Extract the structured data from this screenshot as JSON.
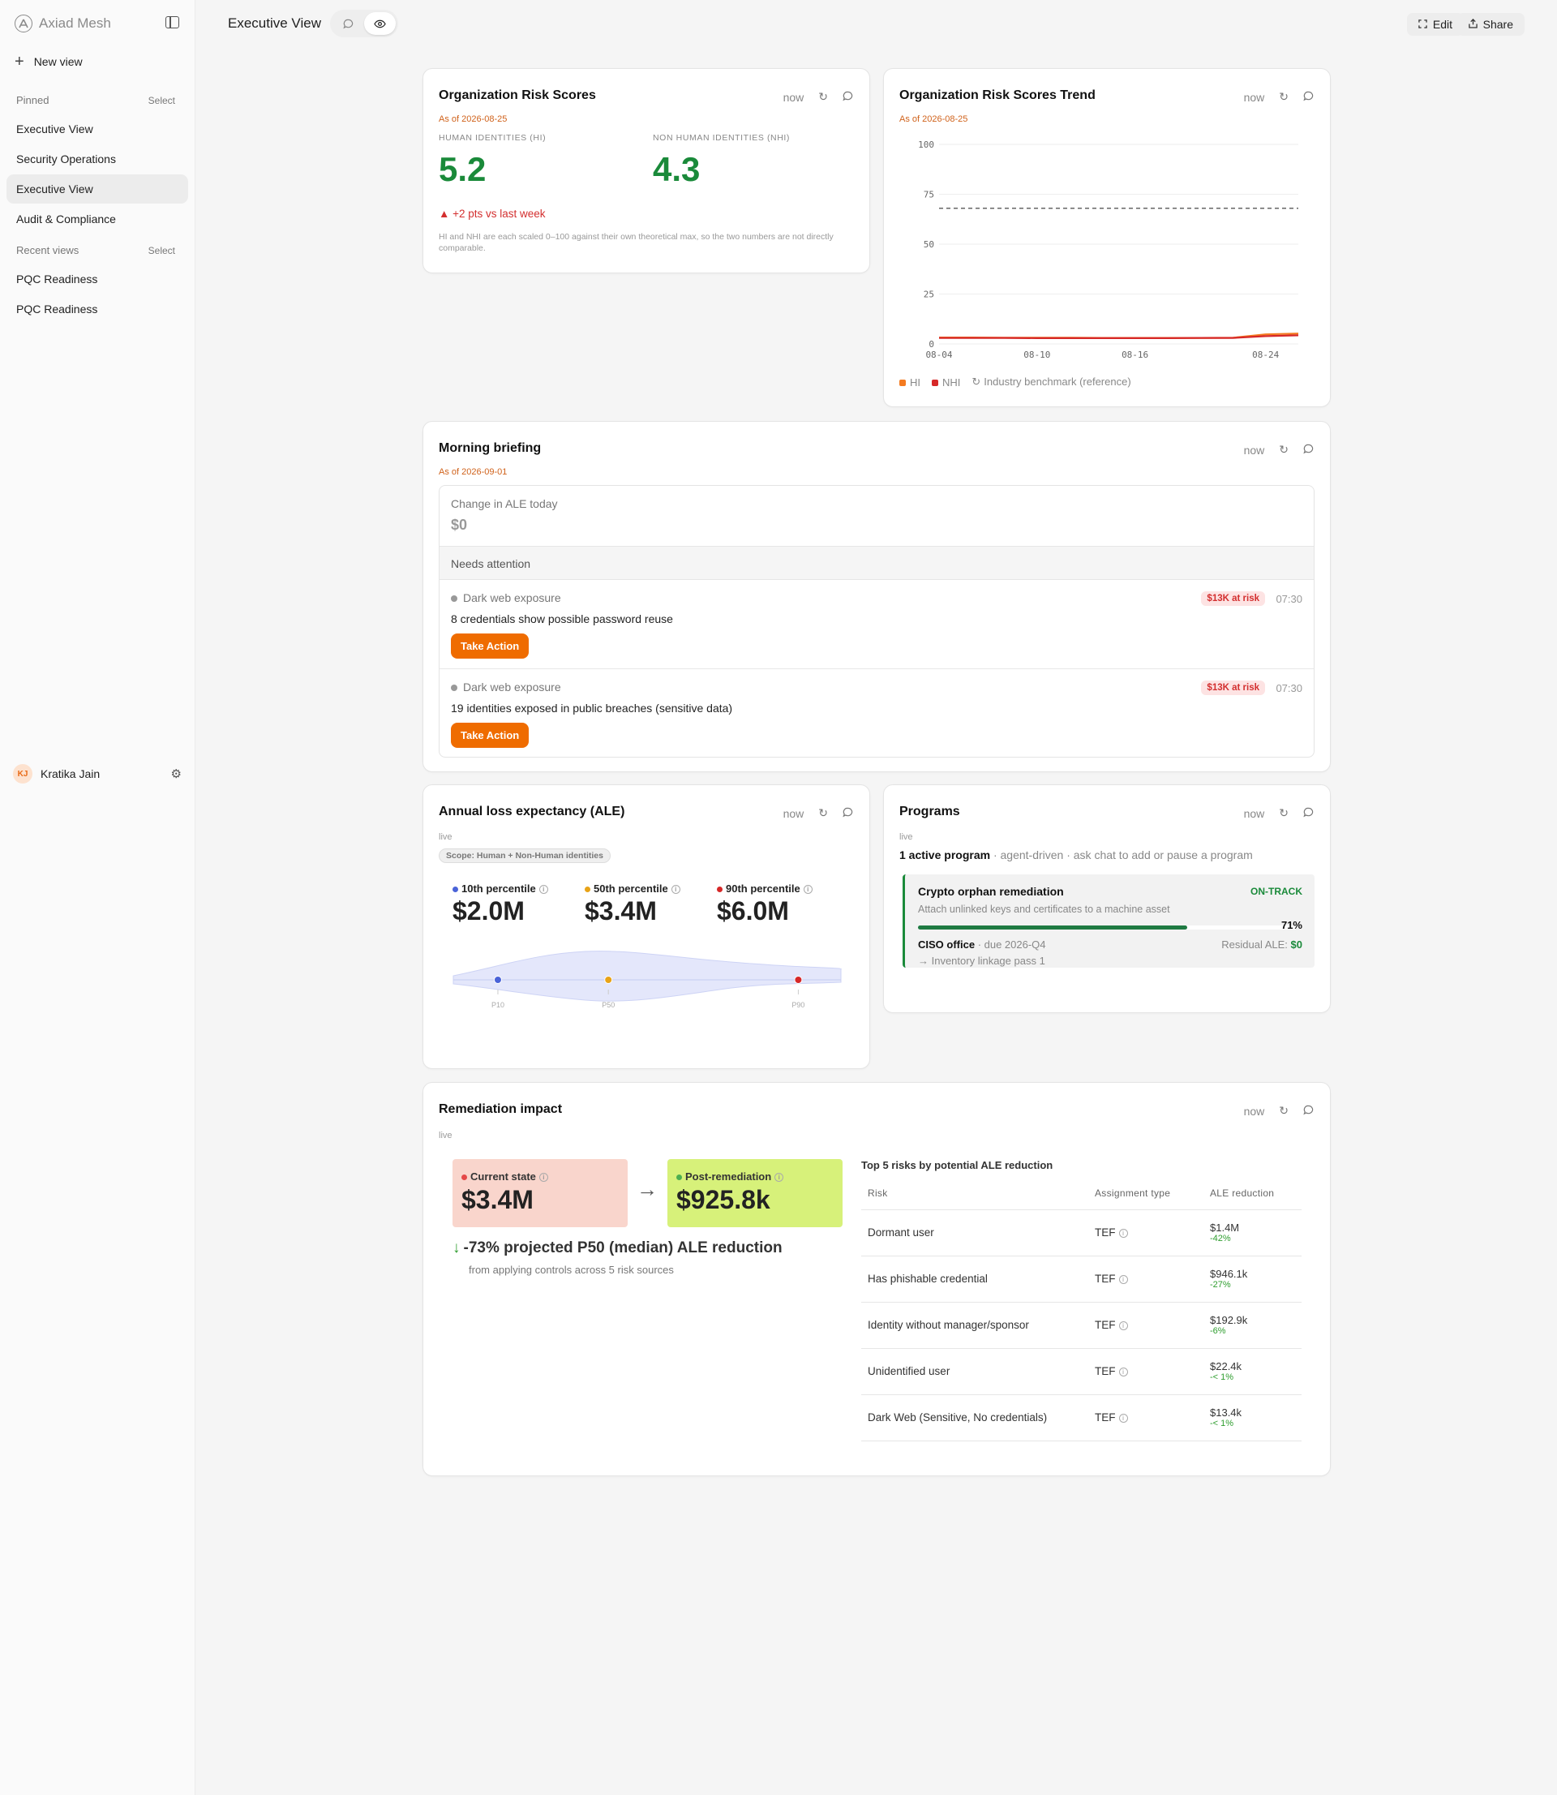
{
  "sidebar": {
    "brand": "Axiad Mesh",
    "new_view": "New view",
    "pinned_label": "Pinned",
    "pinned_select": "Select",
    "pinned": [
      "Executive View",
      "Security Operations",
      "Executive View",
      "Audit & Compliance"
    ],
    "recent_label": "Recent views",
    "recent_select": "Select",
    "recent": [
      "PQC Readiness",
      "PQC Readiness"
    ],
    "user": {
      "initials": "KJ",
      "name": "Kratika Jain"
    }
  },
  "topbar": {
    "title": "Executive View",
    "edit": "Edit",
    "share": "Share"
  },
  "risk_scores": {
    "title": "Organization Risk Scores",
    "refresh": "now",
    "as_of": "As of 2026-08-25",
    "hi_label": "HUMAN IDENTITIES (HI)",
    "hi_value": "5.2",
    "nhi_label": "NON HUMAN IDENTITIES (NHI)",
    "nhi_value": "4.3",
    "delta": "▲ +2 pts vs last week",
    "note": "HI and NHI are each scaled 0–100 against their own theoretical max, so the two numbers are not directly comparable."
  },
  "trend": {
    "title": "Organization Risk Scores Trend",
    "refresh": "now",
    "as_of": "As of 2026-08-25",
    "legend": [
      "HI",
      "NHI",
      "Industry benchmark (reference)"
    ]
  },
  "chart_data": {
    "type": "line",
    "x": [
      "08-04",
      "08-06",
      "08-08",
      "08-10",
      "08-12",
      "08-14",
      "08-16",
      "08-18",
      "08-20",
      "08-22",
      "08-24",
      "08-25"
    ],
    "x_ticks": [
      "08-04",
      "08-10",
      "08-16",
      "08-24"
    ],
    "y_ticks": [
      0,
      25,
      50,
      75,
      100
    ],
    "ylim": [
      0,
      100
    ],
    "series": [
      {
        "name": "HI",
        "color": "#f47b20",
        "values": [
          3.2,
          3.2,
          3.1,
          3.1,
          3.1,
          3.0,
          3.0,
          3.0,
          3.0,
          3.1,
          4.8,
          5.2
        ]
      },
      {
        "name": "NHI",
        "color": "#d62828",
        "values": [
          3.0,
          3.0,
          3.0,
          2.9,
          2.9,
          2.9,
          2.9,
          2.9,
          3.0,
          3.0,
          3.9,
          4.3
        ]
      },
      {
        "name": "Industry benchmark (reference)",
        "color": "#666666",
        "dashed": true,
        "values": [
          68,
          68,
          68,
          68,
          68,
          68,
          68,
          68,
          68,
          68,
          68,
          68
        ]
      }
    ],
    "grid": true,
    "legend": "bottom-left"
  },
  "briefing": {
    "title": "Morning briefing",
    "refresh": "now",
    "as_of": "As of 2026-09-01",
    "change_label": "Change in ALE today",
    "change_value": "$0",
    "needs_attention": "Needs attention",
    "alerts": [
      {
        "category": "Dark web exposure",
        "text": "8 credentials show possible password reuse",
        "badge": "$13K at risk",
        "time": "07:30",
        "action": "Take Action"
      },
      {
        "category": "Dark web exposure",
        "text": "19 identities exposed in public breaches (sensitive data)",
        "badge": "$13K at risk",
        "time": "07:30",
        "action": "Take Action"
      }
    ]
  },
  "ale": {
    "title": "Annual loss expectancy (ALE)",
    "refresh": "now",
    "live": "live",
    "scope": "Scope: Human + Non-Human identities",
    "percentiles": [
      {
        "label": "10th percentile",
        "value": "$2.0M",
        "color": "#4a63d8",
        "short": "P10",
        "pos": 0.115
      },
      {
        "label": "50th percentile",
        "value": "$3.4M",
        "color": "#e8a317",
        "short": "P50",
        "pos": 0.4
      },
      {
        "label": "90th percentile",
        "value": "$6.0M",
        "color": "#d62828",
        "short": "P90",
        "pos": 0.89
      }
    ]
  },
  "programs": {
    "title": "Programs",
    "refresh": "now",
    "live": "live",
    "summary_bold": "1 active program",
    "summary_rest": " · agent-driven · ask chat to add or pause a program",
    "program": {
      "name": "Crypto orphan remediation",
      "status": "ON-TRACK",
      "desc": "Attach unlinked keys and certificates to a machine asset",
      "progress": 0.71,
      "progress_label": "71%",
      "owner": "CISO office",
      "due": " · due 2026-Q4",
      "residual_label": "Residual ALE: ",
      "residual_value": "$0",
      "next": "→ Inventory linkage pass 1"
    }
  },
  "remediation": {
    "title": "Remediation impact",
    "refresh": "now",
    "live": "live",
    "current_label": "Current state",
    "current_value": "$3.4M",
    "post_label": "Post-remediation",
    "post_value": "$925.8k",
    "reduction": "-73% projected P50 (median) ALE reduction",
    "reduction_sub": "from applying controls across 5 risk sources",
    "table_title": "Top 5 risks by potential ALE reduction",
    "columns": [
      "Risk",
      "Assignment type",
      "ALE reduction"
    ],
    "rows": [
      {
        "risk": "Dormant user",
        "type": "TEF",
        "amount": "$1.4M",
        "pct": "-42%"
      },
      {
        "risk": "Has phishable credential",
        "type": "TEF",
        "amount": "$946.1k",
        "pct": "-27%"
      },
      {
        "risk": "Identity without manager/sponsor",
        "type": "TEF",
        "amount": "$192.9k",
        "pct": "-6%"
      },
      {
        "risk": "Unidentified user",
        "type": "TEF",
        "amount": "$22.4k",
        "pct": "-< 1%"
      },
      {
        "risk": "Dark Web (Sensitive, No credentials)",
        "type": "TEF",
        "amount": "$13.4k",
        "pct": "-< 1%"
      }
    ]
  }
}
